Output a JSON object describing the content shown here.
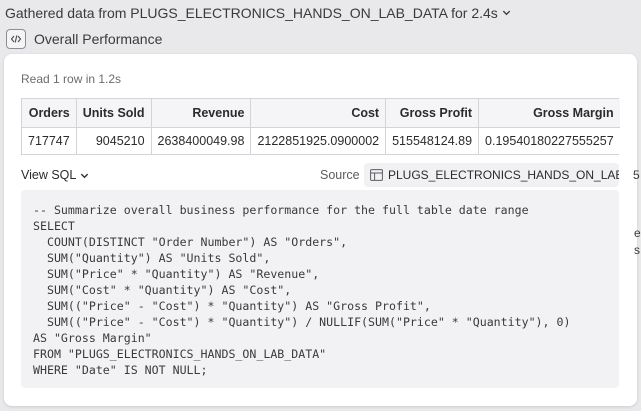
{
  "header": {
    "title": "Gathered data from PLUGS_ELECTRONICS_HANDS_ON_LAB_DATA for 2.4s",
    "chevron_icon": "chevron-down-icon"
  },
  "subheader": {
    "icon": "code-icon",
    "title": "Overall Performance"
  },
  "result": {
    "status": "Read 1 row in 1.2s",
    "columns": [
      "Orders",
      "Units Sold",
      "Revenue",
      "Cost",
      "Gross Profit",
      "Gross Margin"
    ],
    "rows": [
      [
        "717747",
        "9045210",
        "2638400049.98",
        "2122851925.0900002",
        "515548124.89",
        "0.19540180227555257"
      ]
    ]
  },
  "sql": {
    "toggle_label": "View SQL",
    "source_label": "Source",
    "source_name": "PLUGS_ELECTRONICS_HANDS_ON_LAB_DATA",
    "source_icon": "table-icon",
    "code": "-- Summarize overall business performance for the full table date range\nSELECT\n  COUNT(DISTINCT \"Order Number\") AS \"Orders\",\n  SUM(\"Quantity\") AS \"Units Sold\",\n  SUM(\"Price\" * \"Quantity\") AS \"Revenue\",\n  SUM(\"Cost\" * \"Quantity\") AS \"Cost\",\n  SUM((\"Price\" - \"Cost\") * \"Quantity\") AS \"Gross Profit\",\n  SUM((\"Price\" - \"Cost\") * \"Quantity\") / NULLIF(SUM(\"Price\" * \"Quantity\"), 0)\nAS \"Gross Margin\"\nFROM \"PLUGS_ELECTRONICS_HANDS_ON_LAB_DATA\"\nWHERE \"Date\" IS NOT NULL;"
  },
  "edge": {
    "glyph_1": "5",
    "glyph_2": "e",
    "glyph_3": "s"
  }
}
